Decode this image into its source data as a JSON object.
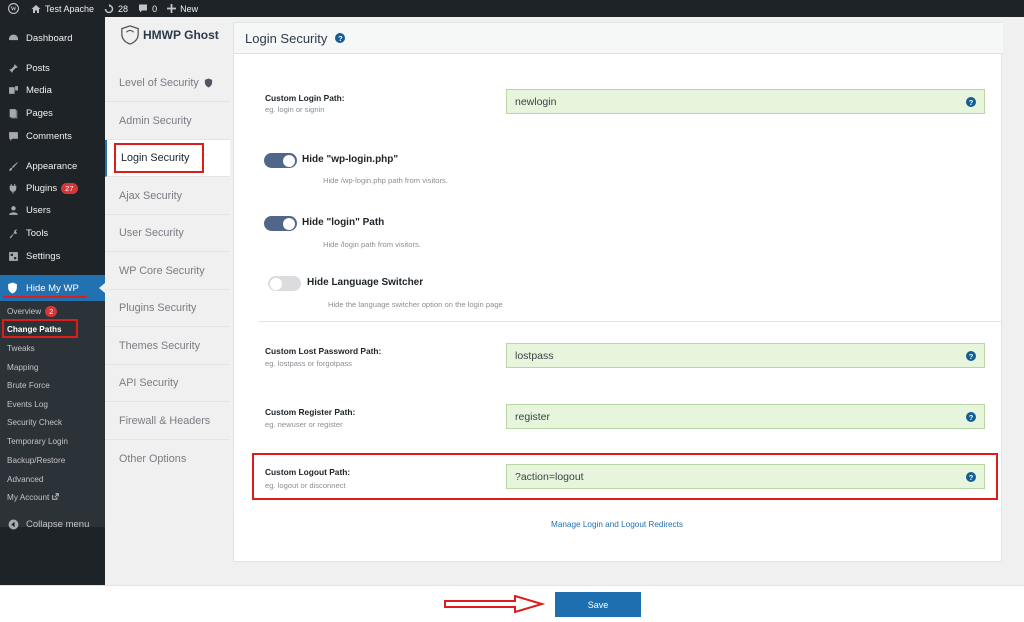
{
  "admin_bar": {
    "site_name": "Test Apache",
    "updates_count": "28",
    "comments_count": "0",
    "new_label": "New"
  },
  "wp_menu": {
    "items": [
      {
        "label": "Dashboard",
        "icon": "dashboard-icon"
      },
      {
        "label": "Posts",
        "icon": "pin-icon"
      },
      {
        "label": "Media",
        "icon": "media-icon"
      },
      {
        "label": "Pages",
        "icon": "pages-icon"
      },
      {
        "label": "Comments",
        "icon": "comment-icon"
      },
      {
        "label": "Appearance",
        "icon": "brush-icon"
      },
      {
        "label": "Plugins",
        "icon": "plug-icon",
        "badge": "27"
      },
      {
        "label": "Users",
        "icon": "users-icon"
      },
      {
        "label": "Tools",
        "icon": "wrench-icon"
      },
      {
        "label": "Settings",
        "icon": "settings-icon"
      }
    ],
    "active": {
      "label": "Hide My WP",
      "icon": "shield-icon"
    },
    "submenu": [
      {
        "label": "Overview",
        "badge": "2"
      },
      {
        "label": "Change Paths",
        "current": true
      },
      {
        "label": "Tweaks"
      },
      {
        "label": "Mapping"
      },
      {
        "label": "Brute Force"
      },
      {
        "label": "Events Log"
      },
      {
        "label": "Security Check"
      },
      {
        "label": "Temporary Login"
      },
      {
        "label": "Backup/Restore"
      },
      {
        "label": "Advanced"
      },
      {
        "label": "My Account"
      }
    ],
    "collapse_label": "Collapse menu"
  },
  "plugin": {
    "logo_text": "HMWP Ghost",
    "nav": [
      "Level of Security",
      "Admin Security",
      "Login Security",
      "Ajax Security",
      "User Security",
      "WP Core Security",
      "Plugins Security",
      "Themes Security",
      "API Security",
      "Firewall & Headers",
      "Other Options"
    ],
    "active_nav": "Login Security"
  },
  "panel": {
    "title": "Login Security",
    "help_mark": "?",
    "login_path": {
      "label": "Custom Login Path:",
      "hint": "eg. login or signin",
      "value": "newlogin"
    },
    "hide_wp_login": {
      "label": "Hide \"wp-login.php\"",
      "hint": "Hide /wp-login.php path from visitors.",
      "enabled": true
    },
    "hide_login": {
      "label": "Hide \"login\" Path",
      "hint": "Hide /login path from visitors.",
      "enabled": true
    },
    "hide_lang": {
      "label": "Hide Language Switcher",
      "hint": "Hide the language switcher option on the login page",
      "enabled": false
    },
    "lost_password": {
      "label": "Custom Lost Password Path:",
      "hint": "eg. lostpass or forgotpass",
      "value": "lostpass"
    },
    "register": {
      "label": "Custom Register Path:",
      "hint": "eg. newuser or register",
      "value": "register"
    },
    "logout": {
      "label": "Custom Logout Path:",
      "hint": "eg. logout or disconnect",
      "value": "?action=logout"
    },
    "redirects_link": "Manage Login and Logout Redirects"
  },
  "save_label": "Save",
  "colors": {
    "accent": "#2271b1",
    "toggle_on": "#50678a",
    "input_bg": "#e6f5dc",
    "annotation": "#dd1c1c"
  }
}
